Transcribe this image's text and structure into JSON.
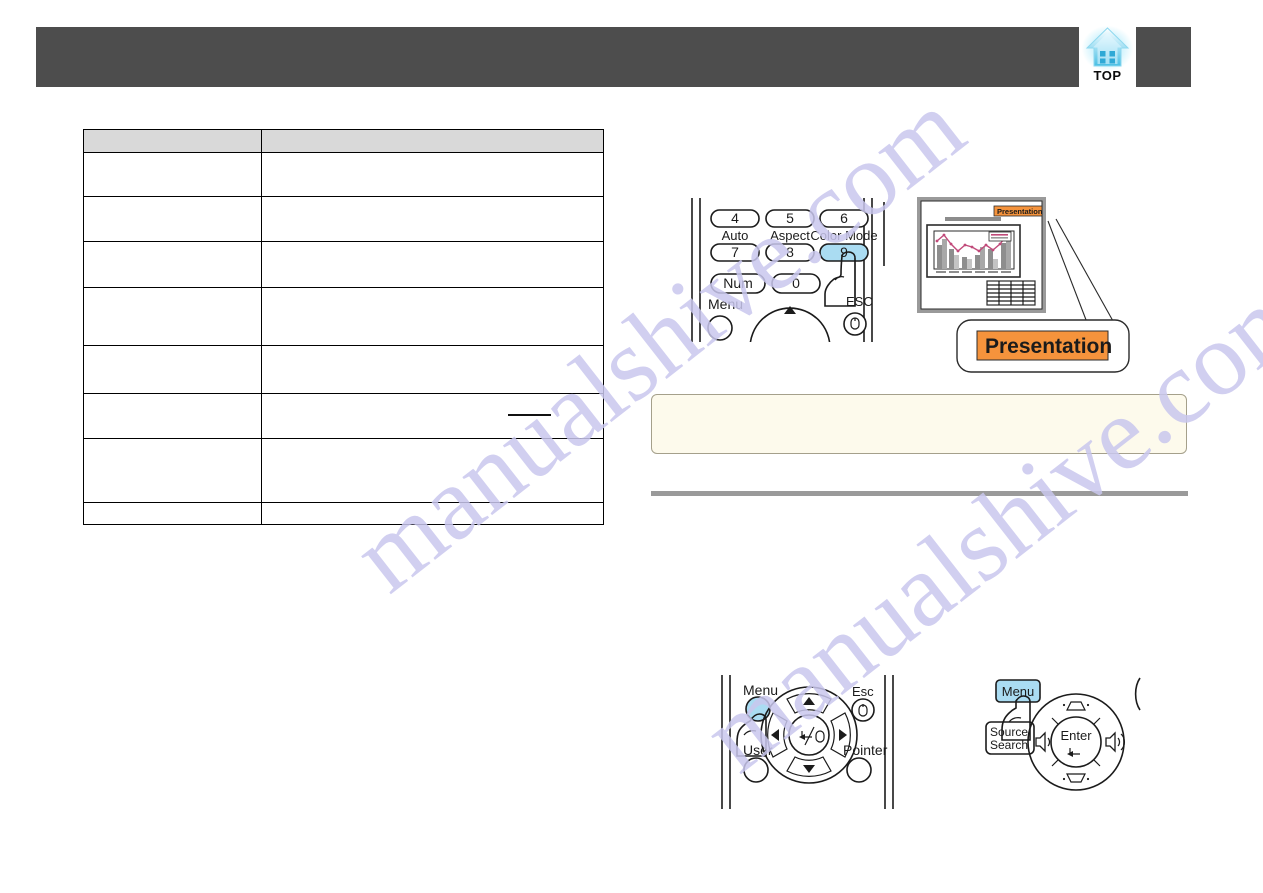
{
  "document": {
    "type": "projector-user-manual-page",
    "watermark": "manualshive.com"
  },
  "header": {
    "bar_color": "#4d4d4d",
    "title": "",
    "top_button": {
      "label": "TOP",
      "icon": "home-top-icon",
      "icon_color": "#7fd4ef"
    }
  },
  "table": {
    "header_bg": "#d9d9d9",
    "columns": [
      {
        "key": "name",
        "label": ""
      },
      {
        "key": "description",
        "label": ""
      }
    ],
    "rows": [
      {
        "name": "",
        "description": ""
      },
      {
        "name": "",
        "description": ""
      },
      {
        "name": "",
        "description": ""
      },
      {
        "name": "",
        "description": ""
      },
      {
        "name": "",
        "description": ""
      },
      {
        "name": "",
        "description": ""
      },
      {
        "name": "",
        "description": ""
      },
      {
        "name": "",
        "description": ""
      }
    ]
  },
  "illustration_remote_top": {
    "caption": "",
    "keys": [
      {
        "label": "4",
        "state": "normal"
      },
      {
        "label": "5",
        "state": "normal"
      },
      {
        "label": "6",
        "state": "normal"
      },
      {
        "label": "7",
        "state": "normal"
      },
      {
        "label": "8",
        "state": "normal"
      },
      {
        "label": "9",
        "state": "highlighted"
      },
      {
        "label": "Num",
        "state": "normal"
      },
      {
        "label": "0",
        "state": "normal"
      }
    ],
    "function_labels": [
      "Auto",
      "Aspect",
      "Color Mode"
    ],
    "other_labels": [
      "Menu",
      "ESC"
    ],
    "highlight_color": "#aadcf2",
    "pressed_key": "9"
  },
  "projection_screen": {
    "badge": "Presentation",
    "badge_color": "#f5933c",
    "chart": {
      "type": "bar-line-combo",
      "bars": [
        30,
        52,
        20,
        27,
        43,
        16,
        48
      ],
      "line": [
        55,
        78,
        35,
        62,
        48,
        40,
        72
      ]
    }
  },
  "callout": {
    "label": "Presentation",
    "badge_color": "#f5933c"
  },
  "note": {
    "text": "",
    "background": "#fdfaec",
    "border": "#a5a08b"
  },
  "illustration_remote_bottom": {
    "labels": {
      "menu": "Menu",
      "esc": "Esc",
      "user": "User",
      "pointer": "Pointer"
    },
    "pressed_key": "Menu",
    "highlight_color": "#aadcf2",
    "dpad": [
      "up",
      "left",
      "right",
      "down",
      "enter"
    ]
  },
  "illustration_control_panel": {
    "labels": {
      "menu": "Menu",
      "source_search_line1": "Source",
      "source_search_line2": "Search",
      "enter": "Enter"
    },
    "pressed_key": "Menu",
    "highlight_color": "#aadcf2",
    "icons": [
      "keystone-up-icon",
      "keystone-down-icon",
      "volume-down-icon",
      "volume-up-icon",
      "enter-arrow-icon"
    ]
  }
}
